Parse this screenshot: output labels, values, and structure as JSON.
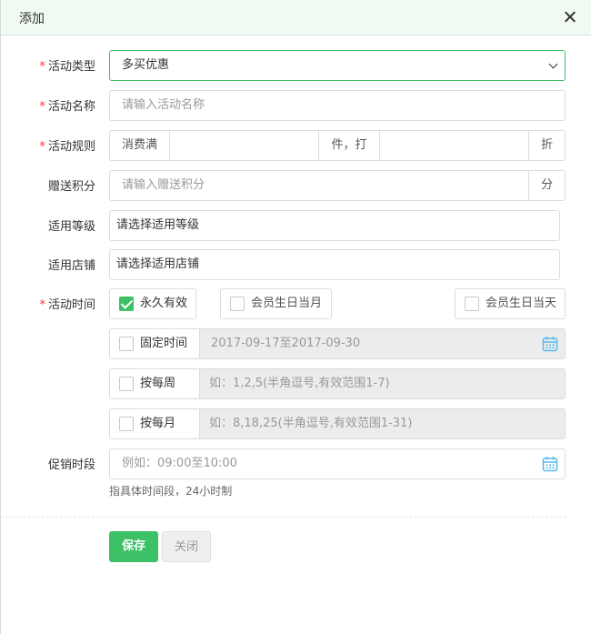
{
  "dialog": {
    "title": "添加"
  },
  "labels": {
    "type": "活动类型",
    "name": "活动名称",
    "rule": "活动规则",
    "points": "赠送积分",
    "level": "适用等级",
    "store": "适用店铺",
    "time": "活动时间",
    "period": "促销时段"
  },
  "type_select": {
    "value": "多买优惠"
  },
  "name_input": {
    "placeholder": "请输入活动名称"
  },
  "rule": {
    "prefix": "消费满",
    "middle": "件，打",
    "suffix": "折"
  },
  "points_input": {
    "placeholder": "请输入赠送积分",
    "suffix": "分"
  },
  "level_input": {
    "placeholder": "请选择适用等级"
  },
  "store_input": {
    "placeholder": "请选择适用店铺"
  },
  "time_options": {
    "forever": {
      "label": "永久有效",
      "checked": true
    },
    "birthday_month": {
      "label": "会员生日当月",
      "checked": false
    },
    "birthday_day": {
      "label": "会员生日当天",
      "checked": false
    },
    "fixed": {
      "label": "固定时间",
      "value": "2017-09-17至2017-09-30",
      "checked": false
    },
    "weekly": {
      "label": "按每周",
      "placeholder": "如：1,2,5(半角逗号,有效范围1-7)",
      "checked": false
    },
    "monthly": {
      "label": "按每月",
      "placeholder": "如：8,18,25(半角逗号,有效范围1-31)",
      "checked": false
    }
  },
  "period_input": {
    "placeholder": "例如：09:00至10:00",
    "hint": "指具体时间段，24小时制"
  },
  "buttons": {
    "save": "保存",
    "close": "关闭"
  },
  "colors": {
    "accent": "#3cc167",
    "required": "#e4393c",
    "calendar": "#5bb8ec"
  }
}
